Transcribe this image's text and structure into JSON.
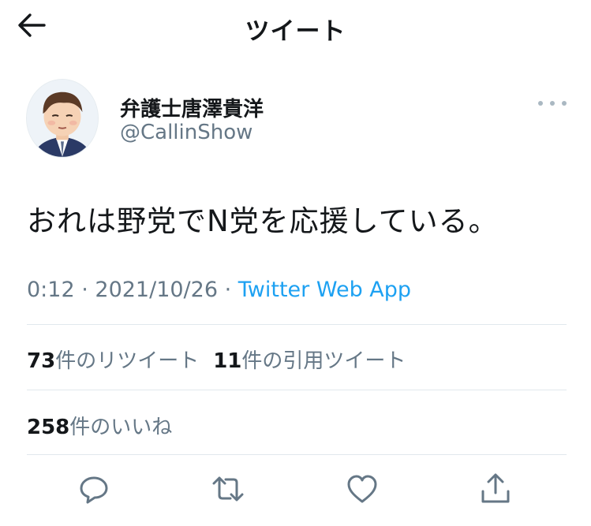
{
  "header": {
    "title": "ツイート"
  },
  "author": {
    "name": "弁護士唐澤貴洋",
    "handle": "@CallinShow"
  },
  "tweet": {
    "text": "おれは野党でN党を応援している。",
    "time": "0:12",
    "separator1": " · ",
    "date": "2021/10/26",
    "separator2": " · ",
    "source": "Twitter Web App"
  },
  "stats": {
    "retweets_count": "73",
    "retweets_label": "件のリツイート",
    "quotes_count": "11",
    "quotes_label": "件の引用ツイート",
    "likes_count": "258",
    "likes_label": "件のいいね"
  },
  "colors": {
    "text": "#14171a",
    "secondary": "#657786",
    "accent": "#1da1f2",
    "divider": "#e1e8ed",
    "icon": "#657786"
  },
  "icons": [
    "back-arrow-icon",
    "more-dots-icon",
    "reply-icon",
    "retweet-icon",
    "like-icon",
    "share-icon"
  ]
}
